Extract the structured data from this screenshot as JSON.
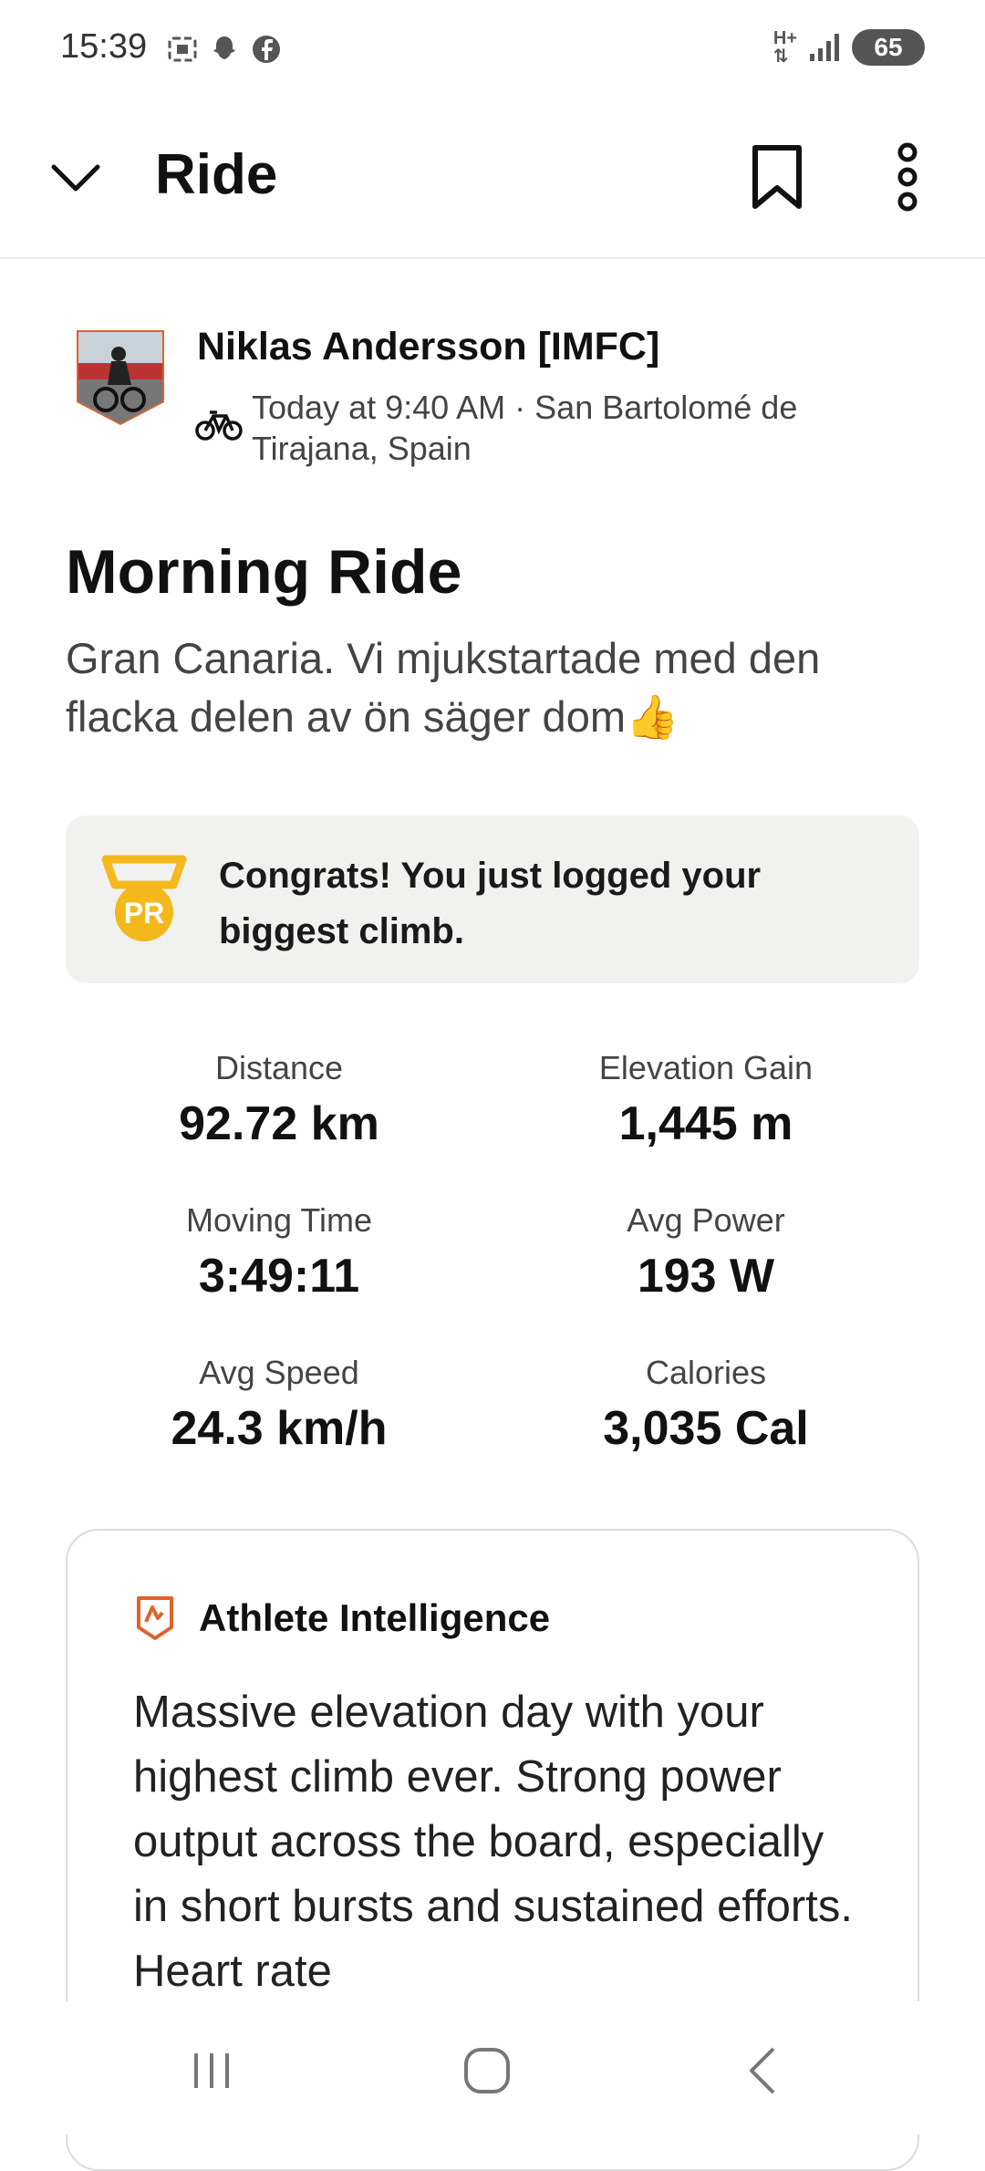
{
  "status_bar": {
    "time": "15:39",
    "left_icons": [
      "screenshot-icon",
      "snapchat-icon",
      "facebook-icon"
    ],
    "network_label": "H+",
    "battery": "65"
  },
  "header": {
    "title": "Ride"
  },
  "athlete": {
    "name": "Niklas Andersson [IMFC]",
    "meta": "Today at 9:40 AM · San Bartolomé de Tirajana, Spain",
    "avatar_border_color": "#e0622a"
  },
  "activity": {
    "title": "Morning Ride",
    "description": "Gran Canaria. Vi mjukstartade med den flacka delen av ön säger dom👍"
  },
  "congrats": {
    "badge_label": "PR",
    "text": "Congrats! You just logged your biggest climb.",
    "badge_color": "#f5b81c"
  },
  "stats": [
    {
      "label": "Distance",
      "value": "92.72 km"
    },
    {
      "label": "Elevation Gain",
      "value": "1,445 m"
    },
    {
      "label": "Moving Time",
      "value": "3:49:11"
    },
    {
      "label": "Avg Power",
      "value": "193 W"
    },
    {
      "label": "Avg Speed",
      "value": "24.3 km/h"
    },
    {
      "label": "Calories",
      "value": "3,035 Cal"
    }
  ],
  "athlete_intelligence": {
    "title": "Athlete Intelligence",
    "text": "Massive elevation day with your highest climb ever. Strong power output across the board, especially in short bursts and sustained efforts. Heart rate",
    "icon_color": "#e0622a"
  }
}
